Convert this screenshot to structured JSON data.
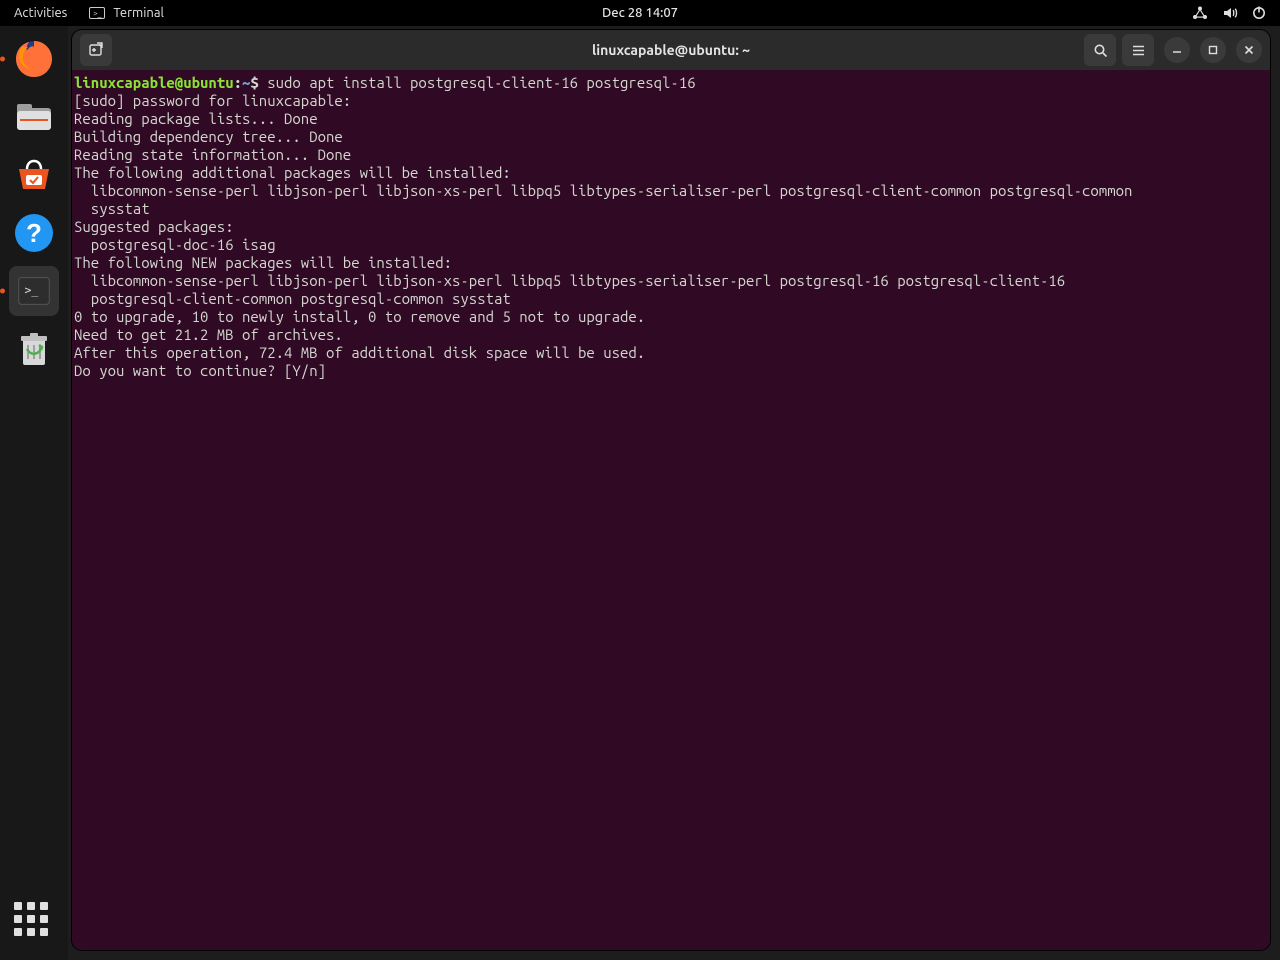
{
  "topbar": {
    "activities": "Activities",
    "app_name": "Terminal",
    "clock": "Dec 28  14:07"
  },
  "dock": {
    "apps": [
      "firefox",
      "files",
      "software",
      "help",
      "terminal",
      "trash"
    ],
    "show_apps_label": "Show Applications"
  },
  "window": {
    "title": "linuxcapable@ubuntu: ~"
  },
  "terminal": {
    "prompt_user": "linuxcapable@ubuntu",
    "prompt_sep1": ":",
    "prompt_path": "~",
    "prompt_sep2": "$ ",
    "command": "sudo apt install postgresql-client-16 postgresql-16",
    "lines": [
      "[sudo] password for linuxcapable:",
      "Reading package lists... Done",
      "Building dependency tree... Done",
      "Reading state information... Done",
      "The following additional packages will be installed:",
      "  libcommon-sense-perl libjson-perl libjson-xs-perl libpq5 libtypes-serialiser-perl postgresql-client-common postgresql-common",
      "  sysstat",
      "Suggested packages:",
      "  postgresql-doc-16 isag",
      "The following NEW packages will be installed:",
      "  libcommon-sense-perl libjson-perl libjson-xs-perl libpq5 libtypes-serialiser-perl postgresql-16 postgresql-client-16",
      "  postgresql-client-common postgresql-common sysstat",
      "0 to upgrade, 10 to newly install, 0 to remove and 5 not to upgrade.",
      "Need to get 21.2 MB of archives.",
      "After this operation, 72.4 MB of additional disk space will be used.",
      "Do you want to continue? [Y/n] "
    ]
  }
}
